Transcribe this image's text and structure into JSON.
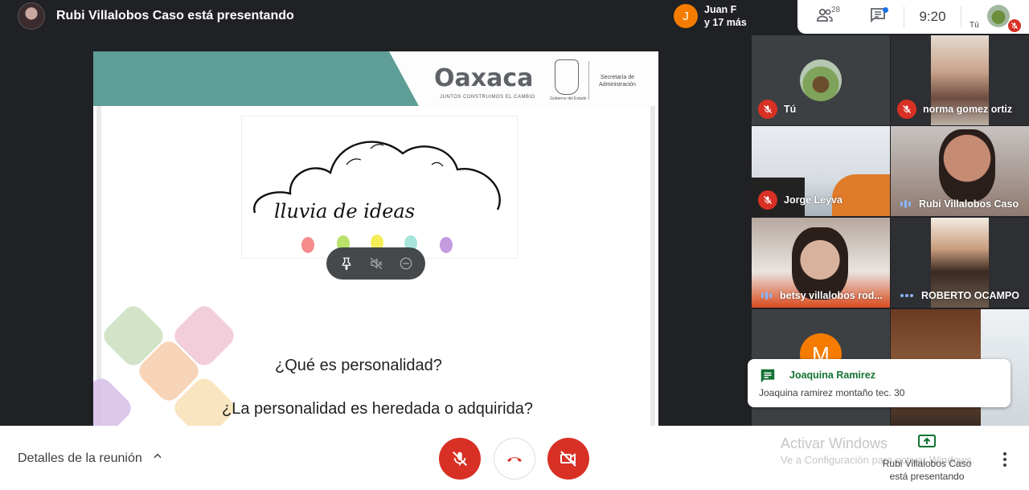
{
  "presenter": {
    "title": "Rubi Villalobos Caso está presentando"
  },
  "joiner": {
    "initial": "J",
    "line1": "Juan F",
    "line2": "y 17 más"
  },
  "top_panel": {
    "people_count": "28",
    "time": "9:20",
    "self_label": "Tú"
  },
  "slide": {
    "logo": "Oaxaca",
    "logo_tagline": "JUNTOS CONSTRUIMOS EL CAMBIO",
    "gov_label": "Gobierno del Estado",
    "secretaria": "Secretaría de Administración",
    "brainstorm_title": "lluvia de ideas",
    "question_1": "¿Qué es personalidad?",
    "question_2": "¿La personalidad es heredada o adquirida?"
  },
  "participants": [
    {
      "name": "Tú",
      "mic": "off"
    },
    {
      "name": "norma gomez ortiz",
      "mic": "off"
    },
    {
      "name": "Jorge Leyva",
      "mic": "off"
    },
    {
      "name": "Rubi Villalobos Caso",
      "mic": "speaking"
    },
    {
      "name": "betsy villalobos rod...",
      "mic": "speaking"
    },
    {
      "name": "ROBERTO OCAMPO",
      "mic": "dots"
    },
    {
      "name": "",
      "initial": "M"
    },
    {
      "name": ""
    }
  ],
  "chat_toast": {
    "sender": "Joaquina Ramirez",
    "message": "Joaquina ramirez montaño tec. 30"
  },
  "bottom": {
    "details_label": "Detalles de la reunión",
    "windows_title": "Activar Windows",
    "windows_sub": "Ve a Configuración para activar Windows.",
    "presenting_line1": "Rubi Villalobos Caso",
    "presenting_line2": "está presentando"
  },
  "colors": {
    "mic_off": "#d93025",
    "accent": "#1a73e8",
    "teal": "#5f9e96",
    "chat_sender": "#137333"
  },
  "icons": [
    "people-icon",
    "chat-icon",
    "mic-off-icon",
    "end-call-icon",
    "camera-off-icon",
    "present-icon",
    "more-icon",
    "pin-icon",
    "mute-icon",
    "remove-icon"
  ]
}
